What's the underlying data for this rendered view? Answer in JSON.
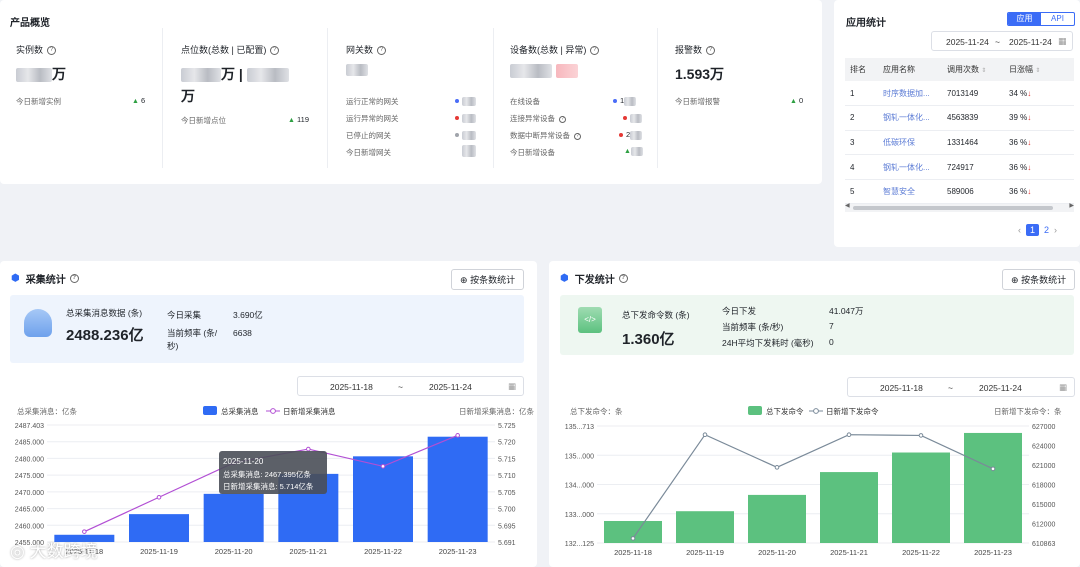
{
  "overview": {
    "title": "产品概览",
    "instances": {
      "label": "实例数",
      "value_unit": "万",
      "sub_label": "今日新增实例",
      "sub_value": "6"
    },
    "points": {
      "label": "点位数(总数 | 已配置)",
      "value_sep": "万 |",
      "value_unit": "万",
      "sub_label": "今日新增点位",
      "sub_value": "119"
    },
    "gateways": {
      "label": "网关数",
      "rows": [
        "运行正常的网关",
        "运行异常的网关",
        "已停止的网关",
        "今日新增网关"
      ]
    },
    "devices": {
      "label": "设备数(总数 | 异常)",
      "rows": [
        "在线设备",
        "连接异常设备",
        "数据中断异常设备",
        "今日新增设备"
      ],
      "row_values": [
        "1",
        "",
        "2",
        ""
      ]
    },
    "alarms": {
      "label": "报警数",
      "value": "1.593万",
      "sub_label": "今日新增报警",
      "sub_value": "0"
    }
  },
  "app_stats": {
    "title": "应用统计",
    "toggle": [
      "应用",
      "API"
    ],
    "date_from": "2025-11-24",
    "date_sep": "~",
    "date_to": "2025-11-24",
    "headers": [
      "排名",
      "应用名称",
      "调用次数",
      "日涨幅"
    ],
    "rows": [
      {
        "rank": "1",
        "name": "时序数据加...",
        "calls": "7013149",
        "change": "34 %"
      },
      {
        "rank": "2",
        "name": "钢轧一体化...",
        "calls": "4563839",
        "change": "39 %"
      },
      {
        "rank": "3",
        "name": "低碳环保",
        "calls": "1331464",
        "change": "36 %"
      },
      {
        "rank": "4",
        "name": "钢轧一体化...",
        "calls": "724917",
        "change": "36 %"
      },
      {
        "rank": "5",
        "name": "智慧安全",
        "calls": "589006",
        "change": "36 %"
      }
    ],
    "pages": [
      "1",
      "2"
    ],
    "colors": {
      "accent": "#3b6cf6",
      "link": "#5b7bd5",
      "down": "#e53935"
    }
  },
  "collect": {
    "title": "采集统计",
    "button": "按条数统计",
    "total_label": "总采集消息数据 (条)",
    "total_value": "2488.236亿",
    "today_label": "今日采集",
    "today_value": "3.690亿",
    "freq_label": "当前频率 (条/秒)",
    "freq_value": "6638",
    "date_from": "2025-11-18",
    "date_sep": "~",
    "date_to": "2025-11-24",
    "left_axis_title": "总采集消息：亿条",
    "right_axis_title": "日新增采集消息：亿条",
    "tooltip": {
      "date": "2025-11-20",
      "line1": "总采集消息: 2467.395亿条",
      "line2": "日新增采集消息: 5.714亿条"
    }
  },
  "issue": {
    "title": "下发统计",
    "button": "按条数统计",
    "total_label": "总下发命令数 (条)",
    "total_value": "1.360亿",
    "today_label": "今日下发",
    "today_value": "41.047万",
    "freq_label": "当前频率 (条/秒)",
    "freq_value": "7",
    "avg_label": "24H平均下发耗时 (毫秒)",
    "avg_value": "0",
    "date_from": "2025-11-18",
    "date_sep": "~",
    "date_to": "2025-11-24",
    "left_axis_title": "总下发命令：条",
    "right_axis_title": "日新增下发命令：条"
  },
  "watermark": "大数跨境",
  "chart_data": [
    {
      "type": "bar",
      "categories": [
        "2025-11-18",
        "2025-11-19",
        "2025-11-20",
        "2025-11-21",
        "2025-11-22",
        "2025-11-23"
      ],
      "series": [
        {
          "name": "总采集消息",
          "type": "bar",
          "axis": "left",
          "color": "#2f6bf4",
          "values": [
            2455.5,
            2461.5,
            2467.395,
            2473.2,
            2478.3,
            2484.0
          ]
        },
        {
          "name": "日新增采集消息",
          "type": "line",
          "axis": "right",
          "color": "#b24fd4",
          "values": [
            5.694,
            5.704,
            5.714,
            5.718,
            5.713,
            5.722
          ]
        }
      ],
      "left_ticks": [
        "2487.403",
        "2485.000",
        "2480.000",
        "2475.000",
        "2470.000",
        "2465.000",
        "2460.000",
        "2455.000"
      ],
      "right_ticks": [
        "5.725",
        "5.720",
        "5.715",
        "5.710",
        "5.705",
        "5.700",
        "5.695",
        "5.691"
      ],
      "ylim_left": [
        2453.4,
        2487.403
      ],
      "ylim_right": [
        5.691,
        5.725
      ],
      "legend": "top-center",
      "grid": true
    },
    {
      "type": "bar",
      "categories": [
        "2025-11-18",
        "2025-11-19",
        "2025-11-20",
        "2025-11-21",
        "2025-11-22",
        "2025-11-23"
      ],
      "series": [
        {
          "name": "总下发命令",
          "type": "bar",
          "axis": "left",
          "color": "#5cc17f",
          "values": [
            132.8,
            133.1,
            133.6,
            134.3,
            134.9,
            135.5
          ]
        },
        {
          "name": "日新增下发命令",
          "type": "line",
          "axis": "right",
          "color": "#7a8a99",
          "values": [
            611500,
            625800,
            621300,
            625800,
            625700,
            621100
          ]
        }
      ],
      "left_ticks": [
        "135...713",
        "135...000",
        "134...000",
        "133...000",
        "132...125"
      ],
      "right_ticks": [
        "627000",
        "624000",
        "621000",
        "618000",
        "615000",
        "612000",
        "610863"
      ],
      "ylim_left": [
        132.125,
        135.713
      ],
      "ylim_right": [
        610863,
        627000
      ],
      "legend": "top-center",
      "grid": true
    }
  ]
}
